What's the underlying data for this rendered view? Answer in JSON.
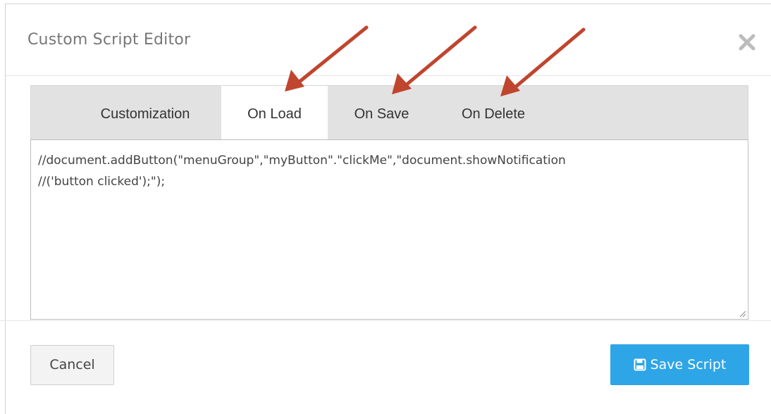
{
  "dialog": {
    "title": "Custom Script Editor",
    "close_icon": "close-icon"
  },
  "tabs": [
    {
      "label": "Customization",
      "active": false
    },
    {
      "label": "On Load",
      "active": true
    },
    {
      "label": "On Save",
      "active": false
    },
    {
      "label": "On Delete",
      "active": false
    }
  ],
  "editor": {
    "lines": [
      "//document.addButton(\"menuGroup\",\"myButton\".\"clickMe\",\"document.showNotification",
      "//('button clicked');\");"
    ]
  },
  "footer": {
    "cancel_label": "Cancel",
    "save_label": "Save Script",
    "save_icon": "floppy-disk-icon"
  },
  "colors": {
    "accent": "#2ea5e6",
    "annotation_arrow": "#c0452e",
    "tab_bar": "#e2e2e2"
  }
}
